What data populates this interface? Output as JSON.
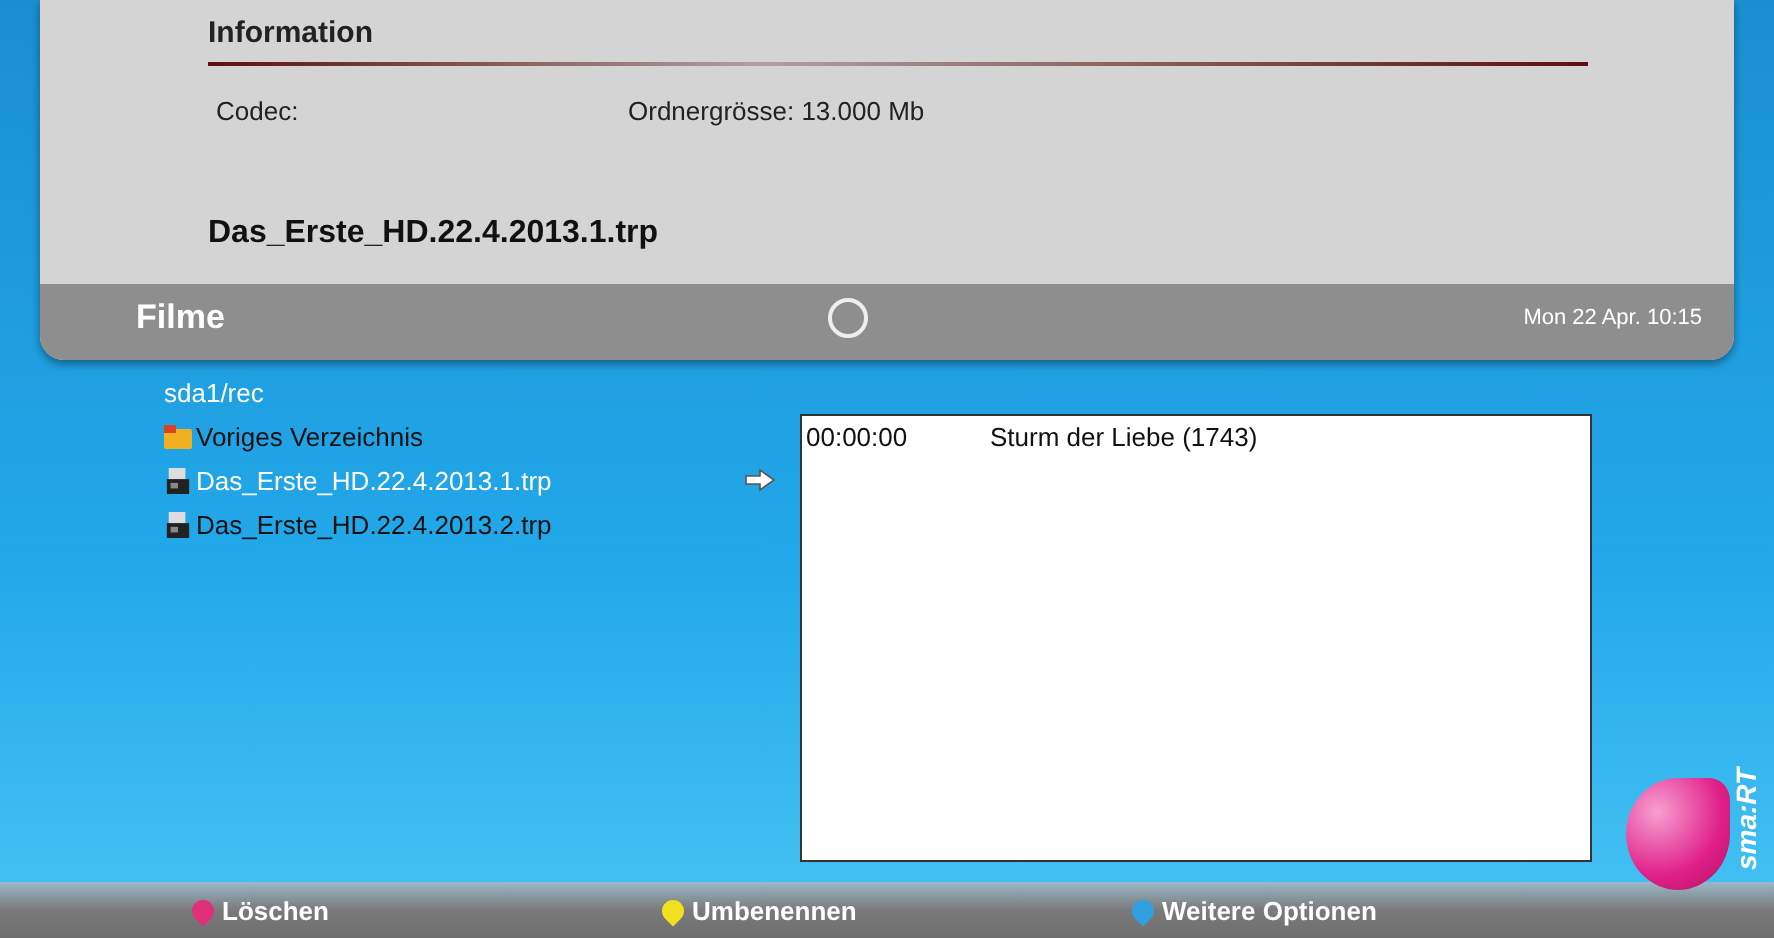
{
  "info": {
    "heading": "Information",
    "codec_label": "Codec:",
    "folder_size": "Ordnergrösse: 13.000  Mb",
    "file_name": "Das_Erste_HD.22.4.2013.1.trp"
  },
  "header": {
    "title": "Filme",
    "datetime": "Mon 22 Apr. 10:15"
  },
  "path": "sda1/rec",
  "files": [
    {
      "kind": "folder",
      "name": "Voriges Verzeichnis",
      "selected": false
    },
    {
      "kind": "file",
      "name": "Das_Erste_HD.22.4.2013.1.trp",
      "selected": true
    },
    {
      "kind": "file",
      "name": "Das_Erste_HD.22.4.2013.2.trp",
      "selected": false
    }
  ],
  "epg": [
    {
      "time": "00:00:00",
      "title": "Sturm der Liebe (1743)"
    }
  ],
  "logo": "sma:RT",
  "color_keys": [
    {
      "label": "Löschen",
      "color": "#e0307a"
    },
    {
      "label": "Umbenennen",
      "color": "#f0e020"
    },
    {
      "label": "Weitere Optionen",
      "color": "#30a0e0"
    }
  ]
}
